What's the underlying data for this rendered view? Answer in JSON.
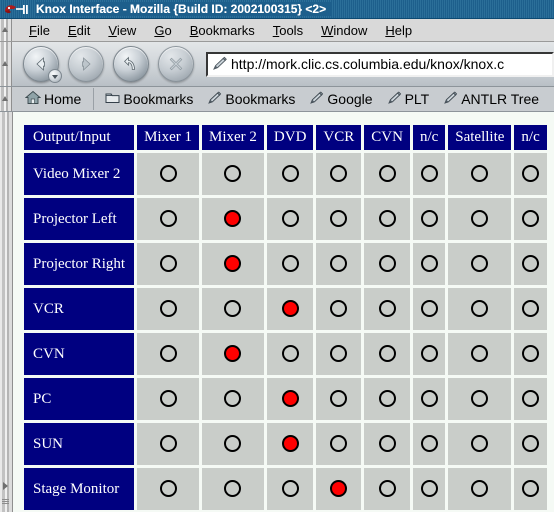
{
  "window": {
    "title": "Knox Interface - Mozilla {Build ID: 2002100315} <2>",
    "app_icon": "mozilla-lizard-icon"
  },
  "menubar": {
    "items": [
      {
        "label": "File",
        "accesskey": "F"
      },
      {
        "label": "Edit",
        "accesskey": "E"
      },
      {
        "label": "View",
        "accesskey": "V"
      },
      {
        "label": "Go",
        "accesskey": "G"
      },
      {
        "label": "Bookmarks",
        "accesskey": "B"
      },
      {
        "label": "Tools",
        "accesskey": "T"
      },
      {
        "label": "Window",
        "accesskey": "W"
      },
      {
        "label": "Help",
        "accesskey": "H"
      }
    ]
  },
  "navbar": {
    "back_label": "Back",
    "forward_label": "Forward",
    "reload_label": "Reload",
    "stop_label": "Stop",
    "url": "http://mork.clic.cs.columbia.edu/knox/knox.c",
    "url_icon": "pencil-icon"
  },
  "bookmarks_toolbar": {
    "items": [
      {
        "label": "Home",
        "icon": "home-icon"
      },
      {
        "label": "Bookmarks",
        "icon": "folder-icon"
      },
      {
        "label": "Bookmarks",
        "icon": "bookmark-pencil-icon"
      },
      {
        "label": "Google",
        "icon": "bookmark-pencil-icon"
      },
      {
        "label": "PLT",
        "icon": "bookmark-pencil-icon"
      },
      {
        "label": "ANTLR Tree",
        "icon": "bookmark-pencil-icon"
      }
    ]
  },
  "matrix": {
    "corner_label": "Output/Input",
    "columns": [
      "Mixer 1",
      "Mixer 2",
      "DVD",
      "VCR",
      "CVN",
      "n/c",
      "Satellite",
      "n/c"
    ],
    "rows": [
      {
        "label": "Video Mixer 2",
        "selected": -1
      },
      {
        "label": "Projector Left",
        "selected": 1
      },
      {
        "label": "Projector Right",
        "selected": 1
      },
      {
        "label": "VCR",
        "selected": 2
      },
      {
        "label": "CVN",
        "selected": 1
      },
      {
        "label": "PC",
        "selected": 2
      },
      {
        "label": "SUN",
        "selected": 2
      },
      {
        "label": "Stage Monitor",
        "selected": 3
      }
    ]
  },
  "colors": {
    "header_bg": "#000080",
    "header_fg": "#ffffff",
    "cell_bg": "#c9cdc9",
    "radio_on": "#ff0000",
    "page_bg": "#f5faf5",
    "titlebar_bg": "#1d5f8c"
  }
}
